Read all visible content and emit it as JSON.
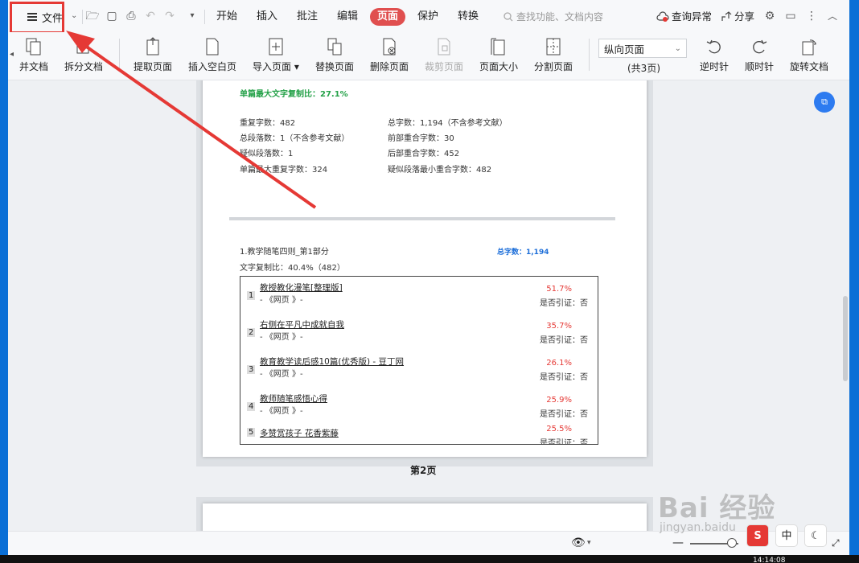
{
  "menubar": {
    "file_label": "文件",
    "tabs": [
      "开始",
      "插入",
      "批注",
      "编辑",
      "页面",
      "保护",
      "转换"
    ],
    "active_tab": "页面",
    "search_placeholder": "查找功能、文档内容",
    "check_anomaly": "查询异常",
    "share": "分享"
  },
  "ribbon": {
    "merge": "并文档",
    "split": "拆分文档",
    "extract": "提取页面",
    "insert_blank": "插入空白页",
    "import": "导入页面",
    "replace": "替换页面",
    "delete": "删除页面",
    "crop": "裁剪页面",
    "page_size": "页面大小",
    "split_page": "分割页面",
    "orientation": "纵向页面",
    "page_count": "(共3页)",
    "rotate_ccw": "逆时针",
    "rotate_cw": "顺时针",
    "rotate_doc": "旋转文档"
  },
  "report": {
    "max_ratio": "单篇最大文字复制比：27.1%",
    "dup_chars": "重复字数：482",
    "total_chars": "总字数：1,194（不含参考文献）",
    "total_paras": "总段落数：1（不含参考文献）",
    "front_overlap": "前部重合字数：30",
    "suspect_paras": "疑似段落数：1",
    "back_overlap": "后部重合字数：452",
    "max_dup": "单篇最大重复字数：324",
    "min_overlap": "疑似段落最小重合字数：482",
    "section_title": "1.教学随笔四则_第1部分",
    "section_total": "总字数：1,194",
    "section_ratio": "文字复制比：40.4%（482）",
    "sources": [
      {
        "num": "1",
        "title": "教授教化漫笔[整理版]",
        "sub": "- 《网页 》-",
        "pct": "51.7%",
        "cite": "是否引证：否"
      },
      {
        "num": "2",
        "title": "右侧在平凡中成就自我",
        "sub": "- 《网页 》-",
        "pct": "35.7%",
        "cite": "是否引证：否"
      },
      {
        "num": "3",
        "title": "教育教学读后感10篇(优秀版) - 豆丁网",
        "sub": "- 《网页 》-",
        "pct": "26.1%",
        "cite": "是否引证：否"
      },
      {
        "num": "4",
        "title": "教师随笔感悟心得",
        "sub": "- 《网页 》-",
        "pct": "25.9%",
        "cite": "是否引证：否"
      },
      {
        "num": "5",
        "title": "多赞赏孩子 花香紫藤",
        "sub": "",
        "pct": "25.5%",
        "cite": "是否引证：否"
      }
    ],
    "page_label": "第2页"
  },
  "ime": {
    "lang": "中"
  },
  "watermark": {
    "main": "Bai 经验",
    "sub": "jingyan.baidu"
  },
  "taskbar": {
    "clock": "14:14:08"
  },
  "colors": {
    "accent": "#e04f4f",
    "annotation": "#e53935",
    "green": "#24a148",
    "blue": "#1e6fd9"
  }
}
